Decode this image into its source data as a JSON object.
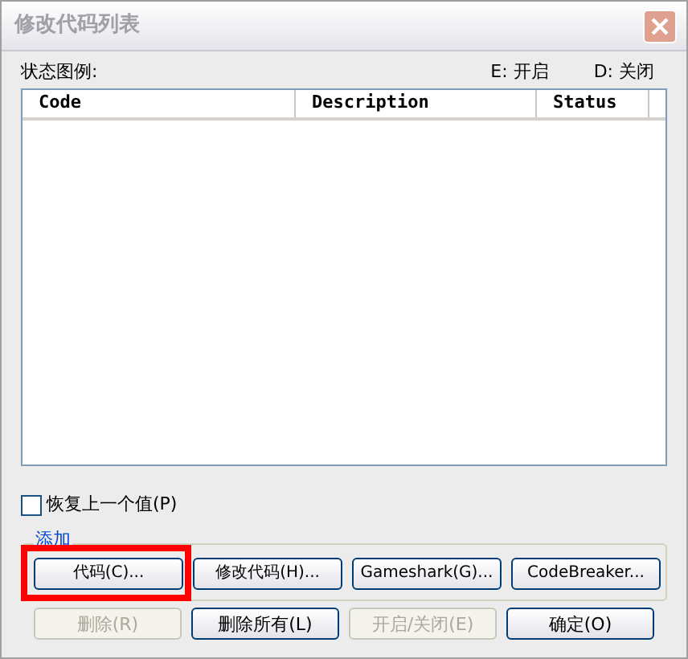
{
  "window": {
    "title": "修改代码列表"
  },
  "legend": {
    "label": "状态图例:",
    "items": [
      "E: 开启",
      "D: 关闭"
    ]
  },
  "table": {
    "columns": [
      "Code",
      "Description",
      "Status"
    ]
  },
  "restore_checkbox": {
    "label": "恢复上一个值(P)",
    "checked": false
  },
  "add_group": {
    "title": "添加",
    "buttons": [
      {
        "label": "代码(C)...",
        "highlighted": true
      },
      {
        "label": "修改代码(H)...",
        "highlighted": false
      },
      {
        "label": "Gameshark(G)...",
        "highlighted": false
      },
      {
        "label": "CodeBreaker...",
        "highlighted": false
      }
    ]
  },
  "buttons": [
    {
      "label": "删除(R)",
      "disabled": true
    },
    {
      "label": "删除所有(L)",
      "disabled": false
    },
    {
      "label": "开启/关闭(E)",
      "disabled": true
    },
    {
      "label": "确定(O)",
      "disabled": false
    }
  ]
}
